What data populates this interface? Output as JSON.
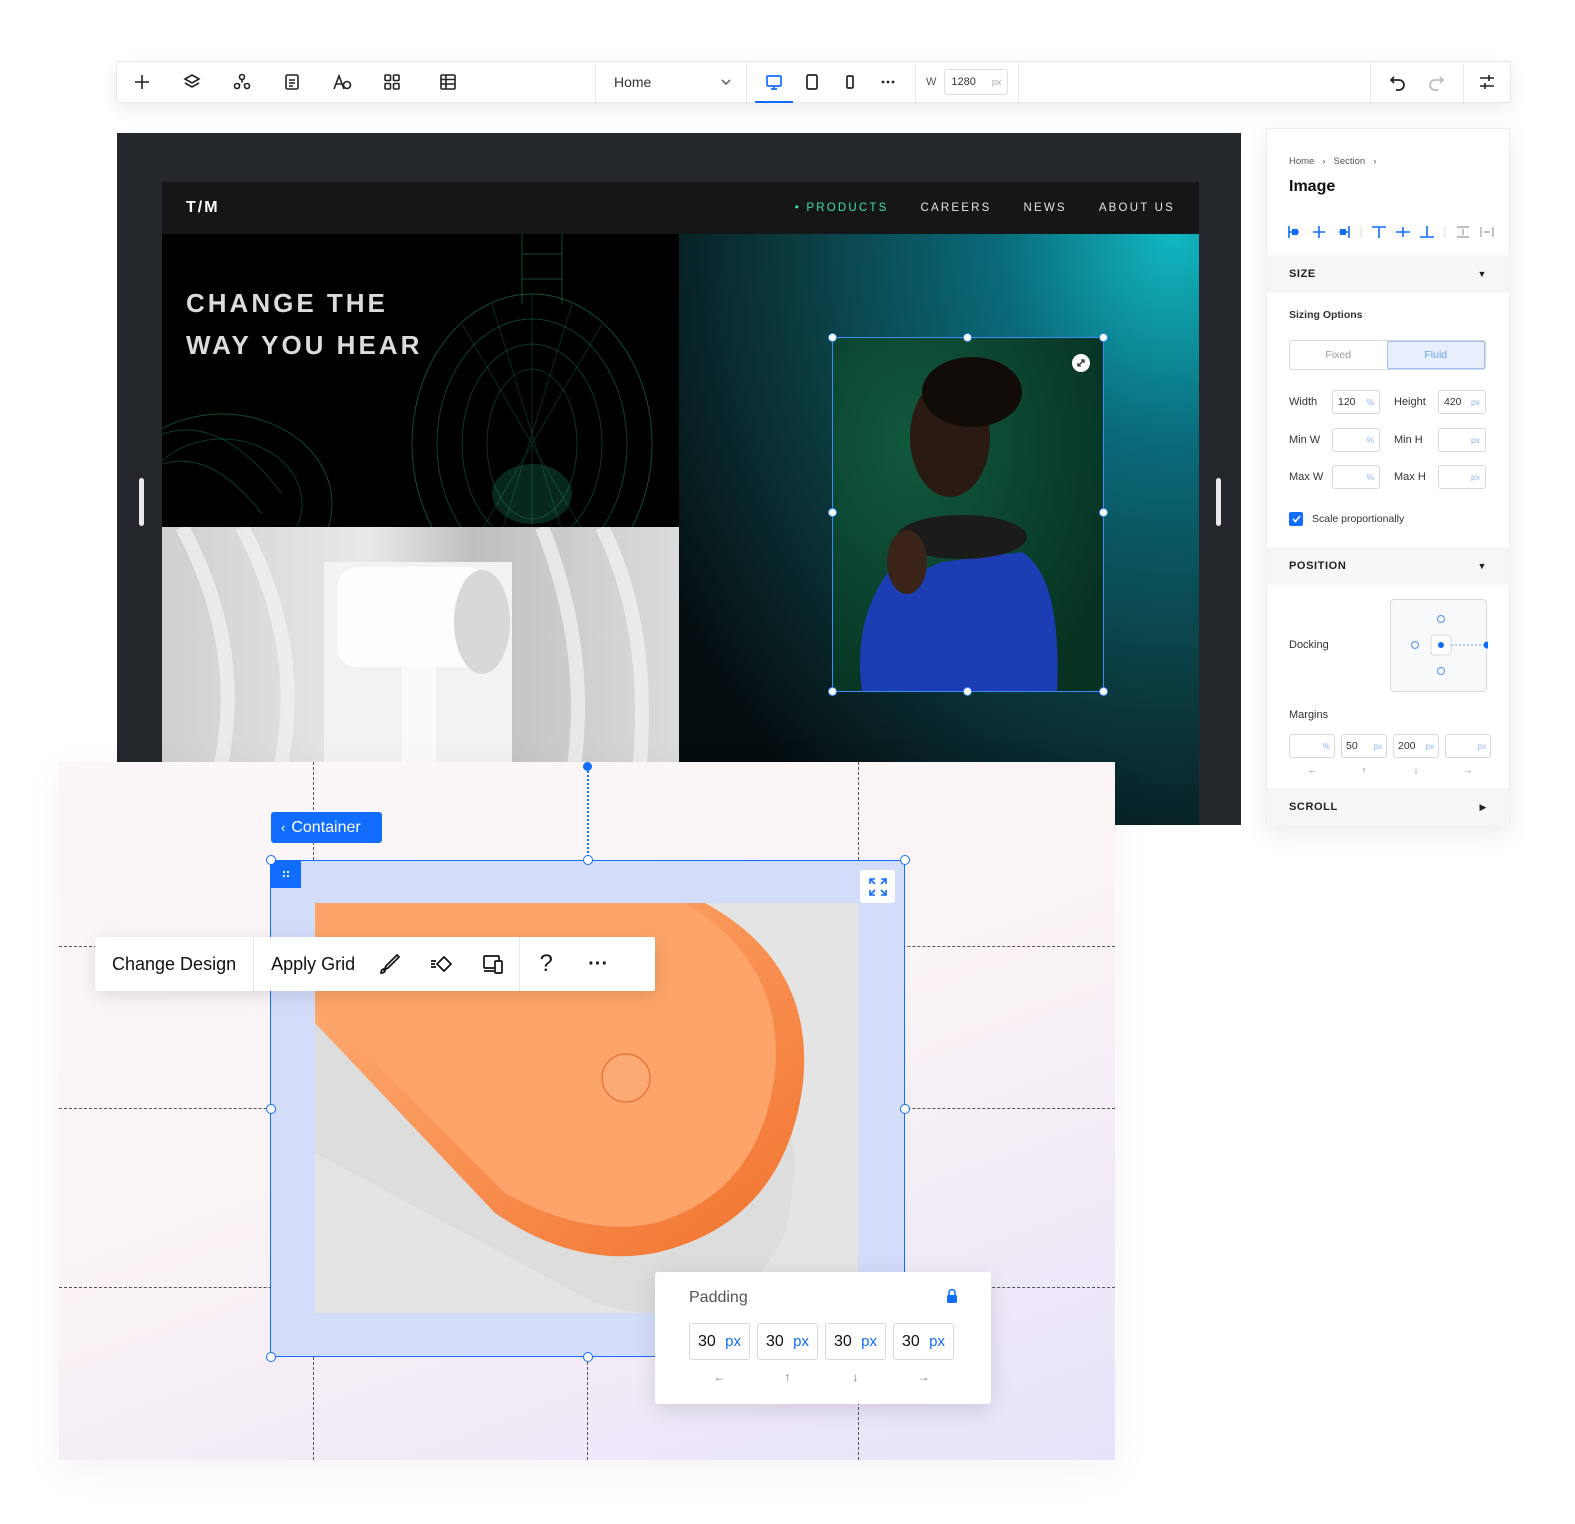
{
  "toolbar": {
    "tools": [
      {
        "name": "add-icon"
      },
      {
        "name": "layers-icon"
      },
      {
        "name": "components-icon"
      },
      {
        "name": "pages-icon"
      },
      {
        "name": "typography-icon"
      },
      {
        "name": "apps-icon"
      },
      {
        "name": "table-icon"
      }
    ],
    "page_selector": "Home",
    "width_label": "W",
    "width_value": "1280",
    "width_unit": "px",
    "accent": "#116dff"
  },
  "site": {
    "logo": "T/M",
    "nav": [
      "PRODUCTS",
      "CAREERS",
      "NEWS",
      "ABOUT US"
    ],
    "headline_line1": "CHANGE THE",
    "headline_line2": "WAY YOU HEAR"
  },
  "inspector": {
    "breadcrumb": [
      "Home",
      "Section"
    ],
    "title": "Image",
    "size": {
      "header": "SIZE",
      "sizing_label": "Sizing Options",
      "options": [
        "Fixed",
        "Fluid"
      ],
      "selected": "Fluid",
      "width_label": "Width",
      "width_value": "120",
      "width_unit": "%",
      "height_label": "Height",
      "height_value": "420",
      "height_unit": "px",
      "min_w_label": "Min W",
      "min_w_unit": "%",
      "min_h_label": "Min H",
      "min_h_unit": "px",
      "max_w_label": "Max W",
      "max_w_unit": "%",
      "max_h_label": "Max H",
      "max_h_unit": "px",
      "scale_label": "Scale proportionally",
      "scale_checked": true
    },
    "position": {
      "header": "POSITION",
      "docking_label": "Docking",
      "margins_label": "Margins",
      "margins": [
        {
          "value": "",
          "unit": "%"
        },
        {
          "value": "50",
          "unit": "px"
        },
        {
          "value": "200",
          "unit": "px"
        },
        {
          "value": "",
          "unit": "px"
        }
      ]
    },
    "scroll": {
      "header": "SCROLL"
    }
  },
  "editor": {
    "container_tag": "Container",
    "context_menu": {
      "change_design": "Change Design",
      "apply_grid": "Apply Grid",
      "help": "?",
      "more": "···"
    },
    "padding": {
      "label": "Padding",
      "values": [
        "30",
        "30",
        "30",
        "30"
      ],
      "unit": "px",
      "arrows": [
        "←",
        "↑",
        "↓",
        "→"
      ]
    }
  }
}
